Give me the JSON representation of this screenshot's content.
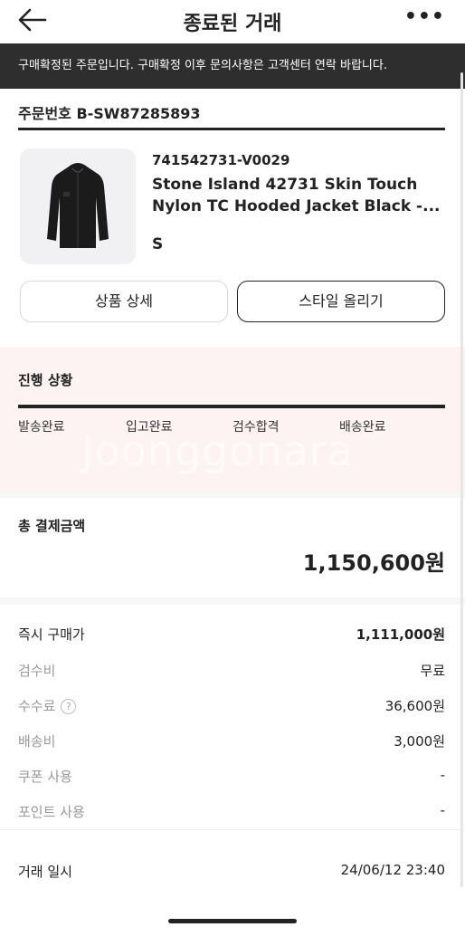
{
  "header": {
    "title": "종료된 거래",
    "back_icon": "back-arrow-icon",
    "more_label": "•••"
  },
  "notice": {
    "text": "구매확정된 주문입니다. 구매확정 이후 문의사항은 고객센터 연락 바랍니다."
  },
  "order": {
    "order_number": "주문번호 B-SW87285893",
    "product_code": "741542731-V0029",
    "product_name": "Stone Island 42731 Skin Touch Nylon TC Hooded Jacket Black -...",
    "size": "S",
    "detail_button": "상품 상세",
    "style_button": "스타일 올리기"
  },
  "progress": {
    "label": "진행 상황",
    "steps": [
      "발송완료",
      "입고완료",
      "검수합격",
      "배송완료"
    ],
    "watermark": "Joonggonara"
  },
  "payment": {
    "total_label": "총 결제금액",
    "total_amount": "1,150,600원",
    "rows": [
      {
        "label": "즉시 구매가",
        "value": "1,111,000원"
      },
      {
        "label": "검수비",
        "value": "무료"
      },
      {
        "label": "수수료",
        "value": "36,600원"
      },
      {
        "label": "배송비",
        "value": "3,000원"
      },
      {
        "label": "쿠폰 사용",
        "value": "-"
      },
      {
        "label": "포인트 사용",
        "value": "-"
      }
    ],
    "fee_help_symbol": "?",
    "date_label": "거래 일시",
    "date_value": "24/06/12 23:40"
  },
  "colors": {
    "notice_bg": "#2e2e2e",
    "progress_bg": "#fdf3f3",
    "text": "#222222",
    "muted": "#999999"
  }
}
